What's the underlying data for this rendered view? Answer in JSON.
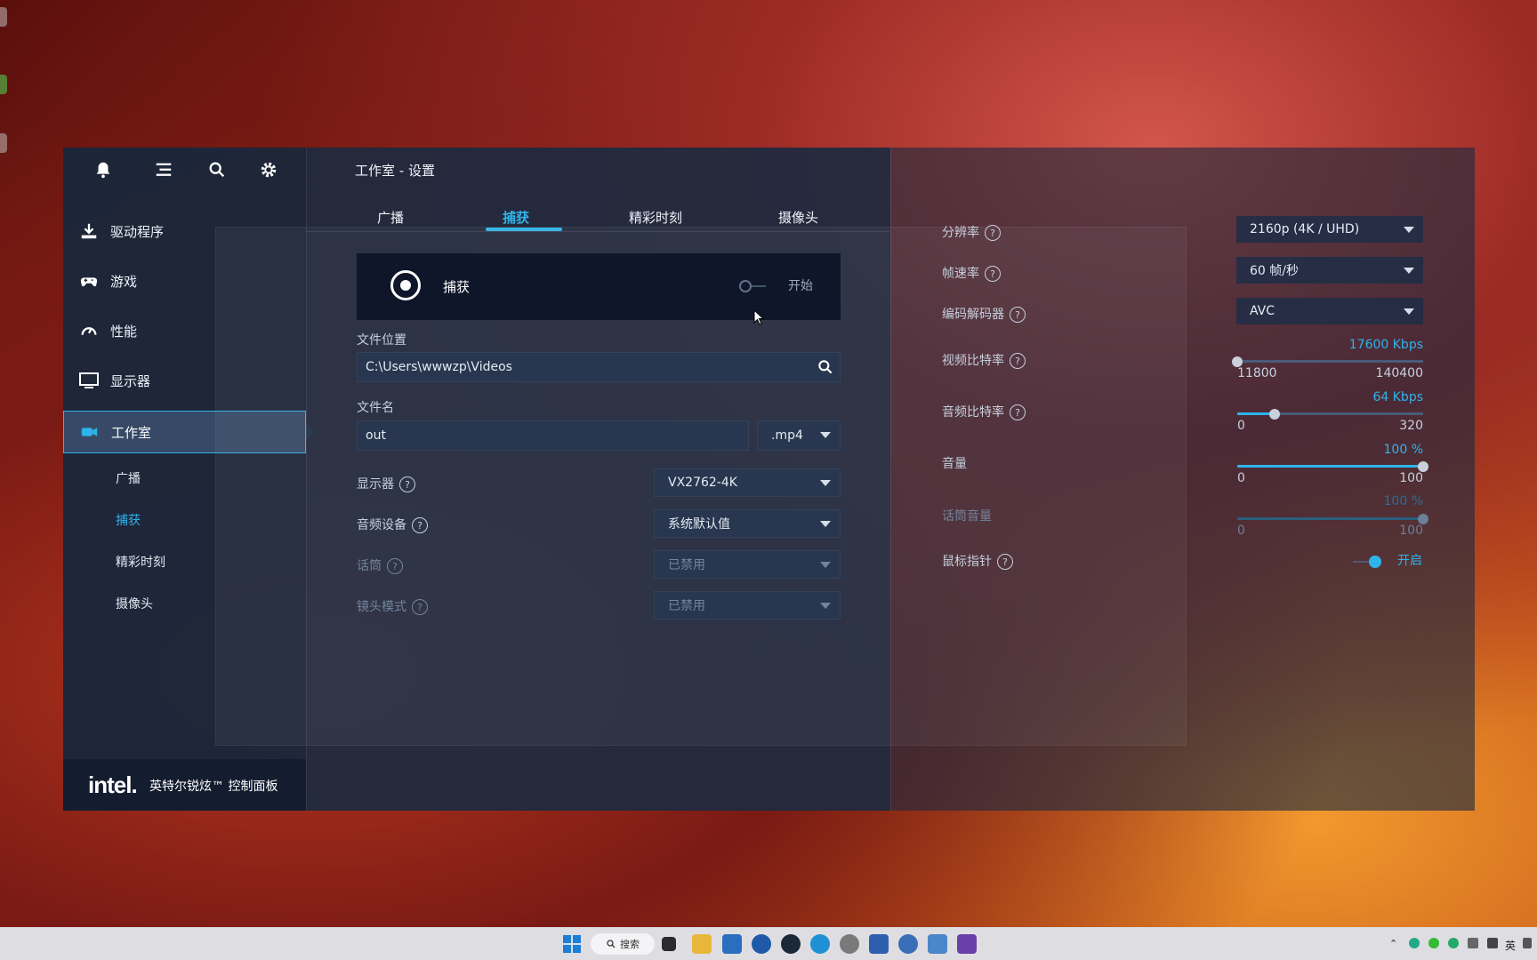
{
  "header": {
    "title": "工作室 - 设置"
  },
  "sidebar": {
    "top_icons": [
      "bell-icon",
      "menu-icon",
      "search-icon",
      "gear-icon"
    ],
    "items": [
      {
        "label": "驱动程序",
        "icon": "download-icon"
      },
      {
        "label": "游戏",
        "icon": "gamepad-icon"
      },
      {
        "label": "性能",
        "icon": "gauge-icon"
      },
      {
        "label": "显示器",
        "icon": "monitor-icon"
      },
      {
        "label": "工作室",
        "icon": "camera-icon",
        "active": true
      }
    ],
    "sub_items": [
      {
        "label": "广播"
      },
      {
        "label": "捕获",
        "active": true
      },
      {
        "label": "精彩时刻"
      },
      {
        "label": "摄像头"
      }
    ]
  },
  "brand": {
    "logo": "intel.",
    "name": "英特尔锐炫™ 控制面板"
  },
  "tabs": [
    {
      "label": "广播"
    },
    {
      "label": "捕获",
      "active": true
    },
    {
      "label": "精彩时刻"
    },
    {
      "label": "摄像头"
    }
  ],
  "capture": {
    "label": "捕获",
    "start_label": "开始"
  },
  "form": {
    "location_label": "文件位置",
    "location_value": "C:\\Users\\wwwzp\\Videos",
    "filename_label": "文件名",
    "filename_value": "out",
    "ext_value": ".mp4",
    "display_label": "显示器",
    "display_value": "VX2762-4K",
    "audio_label": "音频设备",
    "audio_value": "系统默认值",
    "mic_label": "话筒",
    "mic_value": "已禁用",
    "mirror_label": "镜头模式",
    "mirror_value": "已禁用"
  },
  "settings": {
    "resolution_label": "分辨率",
    "resolution_value": "2160p (4K / UHD)",
    "framerate_label": "帧速率",
    "framerate_value": "60 帧/秒",
    "codec_label": "编码解码器",
    "codec_value": "AVC",
    "video_bitrate_label": "视频比特率",
    "video_bitrate_value": "17600 Kbps",
    "video_bitrate_min": "11800",
    "video_bitrate_max": "140400",
    "video_bitrate_level": 0.0,
    "audio_bitrate_label": "音频比特率",
    "audio_bitrate_value": "64 Kbps",
    "audio_bitrate_min": "0",
    "audio_bitrate_max": "320",
    "audio_bitrate_level": 0.2,
    "volume_label": "音量",
    "volume_value": "100 %",
    "volume_min": "0",
    "volume_max": "100",
    "volume_level": 1.0,
    "mic_volume_label": "话筒音量",
    "mic_volume_value": "100 %",
    "mic_volume_min": "0",
    "mic_volume_max": "100",
    "mic_volume_level": 1.0,
    "pointer_label": "鼠标指针",
    "pointer_state": "开启"
  },
  "taskbar": {
    "search_label": "搜索",
    "ime": "英"
  },
  "colors": {
    "accent": "#2fb4ea",
    "panel": "#1c2a40"
  }
}
